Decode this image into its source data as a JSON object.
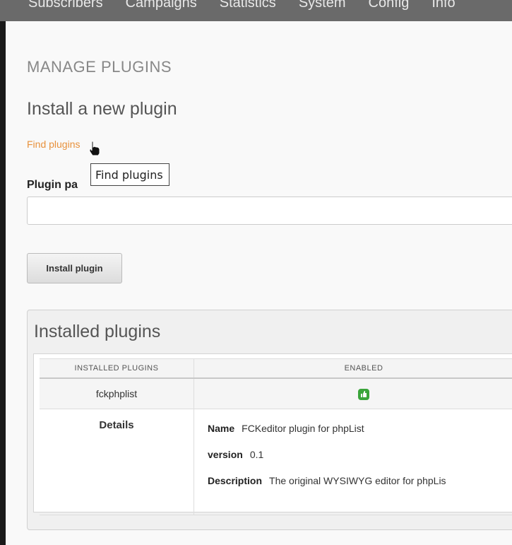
{
  "topnav": {
    "items": [
      "Subscribers",
      "Campaigns",
      "Statistics",
      "System",
      "Config",
      "Info"
    ]
  },
  "page": {
    "heading": "MANAGE PLUGINS",
    "subheading": "Install a new plugin",
    "find_link": "Find plugins",
    "tooltip": "Find plugins",
    "field_label": "Plugin pa",
    "path_value": "",
    "install_button": "Install plugin"
  },
  "installed": {
    "title": "Installed plugins",
    "columns": [
      "INSTALLED PLUGINS",
      "ENABLED"
    ],
    "plugin_name": "fckphplist",
    "enabled_icon": "thumbs-up-icon",
    "enabled_color": "#3aa43a",
    "details_label": "Details",
    "details": {
      "name_label": "Name",
      "name_value": "FCKeditor plugin for phpList",
      "version_label": "version",
      "version_value": "0.1",
      "description_label": "Description",
      "description_value": "The original WYSIWYG editor for phpLis"
    }
  },
  "colors": {
    "link": "#e8913c",
    "nav_bg": "#6a6a6a"
  }
}
